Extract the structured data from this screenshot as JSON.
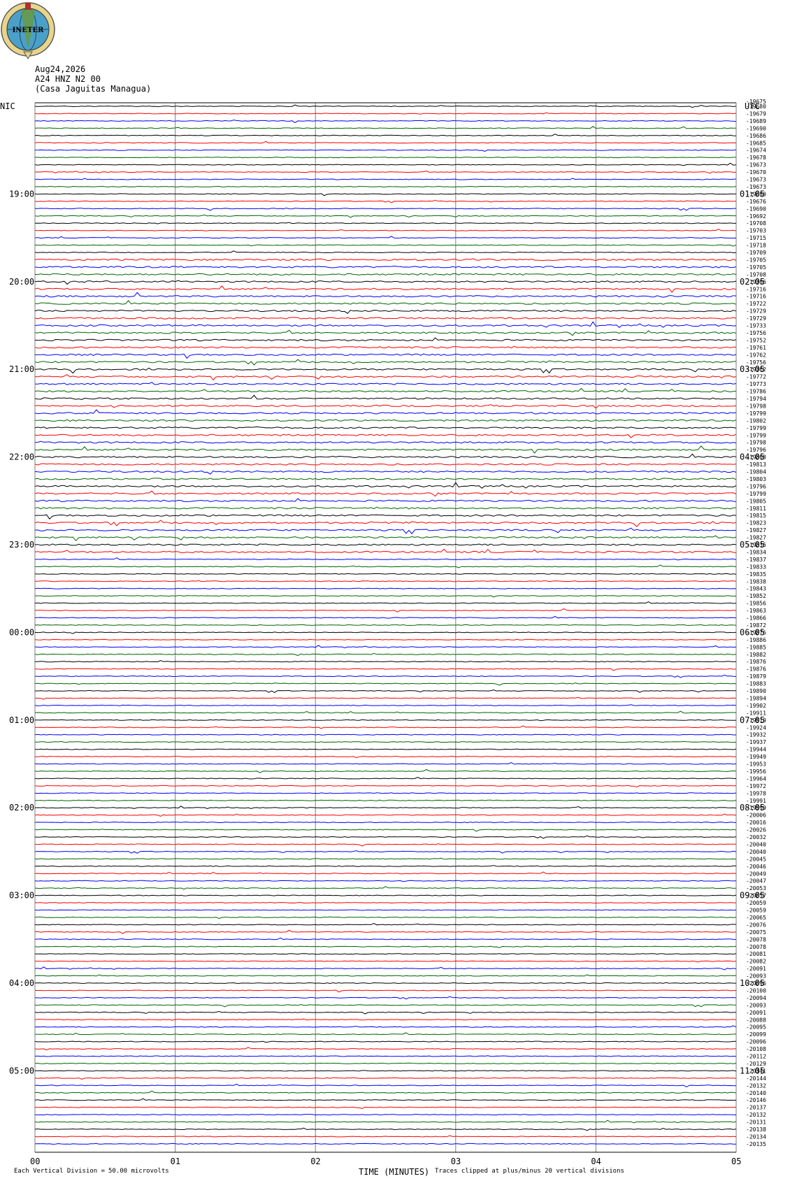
{
  "header": {
    "date": "Aug24,2026",
    "station": "A24 HNZ N2 00",
    "location": "(Casa Jaguitas Managua)",
    "left_zone": "NIC",
    "right_zone": "UTC",
    "logo_text": "INETER"
  },
  "footer": {
    "division_label": "Each Vertical Division =",
    "division_value": "50.00 microvolts",
    "xlabel": "TIME (MINUTES)",
    "clip_note": "Traces clipped at plus/minus 20 vertical divisions"
  },
  "colors": {
    "trace_cycle": [
      "#000000",
      "#ff0000",
      "#0000ff",
      "#006400"
    ],
    "grid": "#808080"
  },
  "chart_data": {
    "type": "line",
    "title": "A24 HNZ N2 00",
    "xlabel": "TIME (MINUTES)",
    "x_ticks": [
      "00",
      "01",
      "02",
      "03",
      "04",
      "05"
    ],
    "xlim": [
      0,
      5
    ],
    "left_hour_labels": [
      "19:00",
      "20:00",
      "21:00",
      "22:00",
      "23:00",
      "00:00",
      "01:00",
      "02:00",
      "03:00",
      "04:00",
      "05:00"
    ],
    "right_hour_labels": [
      "01:05",
      "02:05",
      "03:05",
      "04:05",
      "05:05",
      "06:05",
      "07:05",
      "08:05",
      "09:05",
      "10:05",
      "11:05"
    ],
    "trace_offsets_top_label": "-19675",
    "trace_offsets": [
      "-19680",
      "-19679",
      "-19689",
      "-19690",
      "-19686",
      "-19685",
      "-19674",
      "-19678",
      "-19673",
      "-19670",
      "-19673",
      "-19673",
      "-19680",
      "-19676",
      "-19690",
      "-19692",
      "-19708",
      "-19703",
      "-19715",
      "-19718",
      "-19709",
      "-19705",
      "-19705",
      "-19708",
      "-19706",
      "-19716",
      "-19716",
      "-19722",
      "-19729",
      "-19729",
      "-19733",
      "-19756",
      "-19752",
      "-19761",
      "-19762",
      "-19756",
      "-19762",
      "-19772",
      "-19773",
      "-19786",
      "-19794",
      "-19798",
      "-19799",
      "-19802",
      "-19799",
      "-19799",
      "-19798",
      "-19796",
      "-19808",
      "-19813",
      "-19804",
      "-19803",
      "-19796",
      "-19799",
      "-19805",
      "-19811",
      "-19815",
      "-19823",
      "-19827",
      "-19827",
      "-19835",
      "-19834",
      "-19837",
      "-19833",
      "-19835",
      "-19838",
      "-19843",
      "-19852",
      "-19856",
      "-19863",
      "-19866",
      "-19872",
      "-19876",
      "-19886",
      "-19885",
      "-19882",
      "-19876",
      "-19876",
      "-19879",
      "-19883",
      "-19890",
      "-19894",
      "-19902",
      "-19911",
      "-19919",
      "-19924",
      "-19932",
      "-19937",
      "-19944",
      "-19949",
      "-19953",
      "-19956",
      "-19964",
      "-19972",
      "-19978",
      "-19991",
      "-19999",
      "-20006",
      "-20016",
      "-20026",
      "-20032",
      "-20040",
      "-20040",
      "-20045",
      "-20046",
      "-20049",
      "-20047",
      "-20053",
      "-20057",
      "-20059",
      "-20059",
      "-20065",
      "-20076",
      "-20075",
      "-20078",
      "-20078",
      "-20081",
      "-20082",
      "-20091",
      "-20093",
      "-20096",
      "-20100",
      "-20094",
      "-20093",
      "-20091",
      "-20088",
      "-20095",
      "-20099",
      "-20096",
      "-20108",
      "-20112",
      "-20129",
      "-20141",
      "-20144",
      "-20132",
      "-20140",
      "-20146",
      "-20137",
      "-20132",
      "-20131",
      "-20138",
      "-20134",
      "-20135"
    ],
    "series": [
      {
        "values": [
          0
        ]
      }
    ]
  }
}
